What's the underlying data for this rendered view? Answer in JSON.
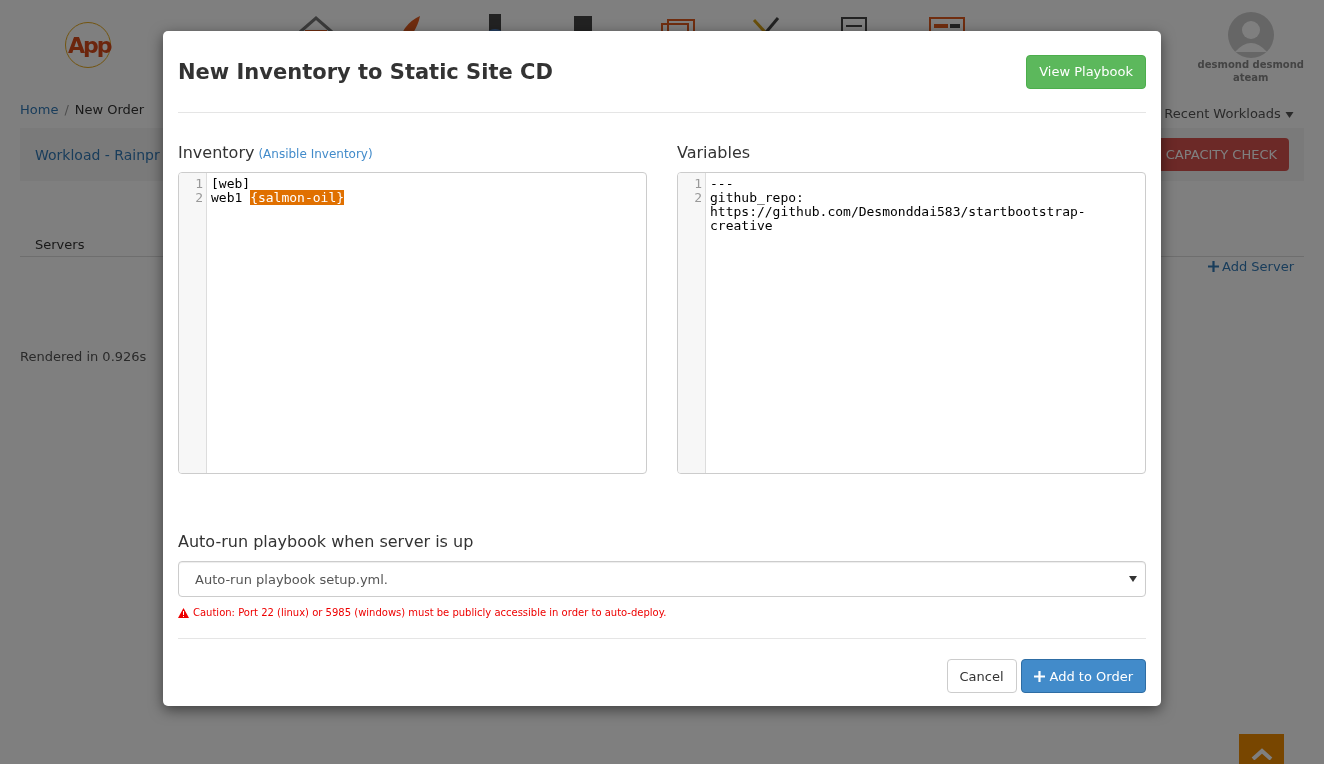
{
  "header": {
    "logo": "App",
    "user": {
      "name": "desmond desmond",
      "team": "ateam"
    }
  },
  "breadcrumb": {
    "separator": "/",
    "items": [
      {
        "label": "Home",
        "link": true
      },
      {
        "label": "New Order",
        "link": false
      }
    ]
  },
  "recent_workloads": "Recent Workloads",
  "workload_panel": {
    "title": "Workload - Rainpr",
    "button": "CAPACITY CHECK"
  },
  "tabs": [
    {
      "label": "Servers",
      "selected": true
    }
  ],
  "add_server": "Add Server",
  "footer_text": "Rendered in 0.926s",
  "modal": {
    "title": "New Inventory to Static Site CD",
    "header_button": "View Playbook",
    "editors": [
      {
        "label": "Inventory",
        "link": "(Ansible Inventory)",
        "lines": [
          {
            "number": "1",
            "segments": [
              {
                "text": "[web]",
                "highlight": false
              }
            ]
          },
          {
            "number": "2",
            "segments": [
              {
                "text": "web1 ",
                "highlight": false
              },
              {
                "text": "{salmon-oil}",
                "highlight": true
              }
            ]
          }
        ]
      },
      {
        "label": "Variables",
        "lines": [
          {
            "number": "1",
            "segments": [
              {
                "text": "---",
                "highlight": false
              }
            ]
          },
          {
            "number": "2",
            "segments": [
              {
                "text": "github_repo: https://github.com/Desmonddai583/startbootstrap-creative",
                "highlight": false
              }
            ]
          }
        ]
      }
    ],
    "autorun_label": "Auto-run playbook when server is up",
    "autorun_value": "Auto-run playbook setup.yml.",
    "caution": "Caution: Port 22 (linux) or 5985 (windows) must be publicly accessible in order to auto-deploy.",
    "buttons": [
      {
        "label": "Cancel",
        "kind": "default"
      },
      {
        "label": "Add to Order",
        "kind": "primary"
      }
    ]
  }
}
